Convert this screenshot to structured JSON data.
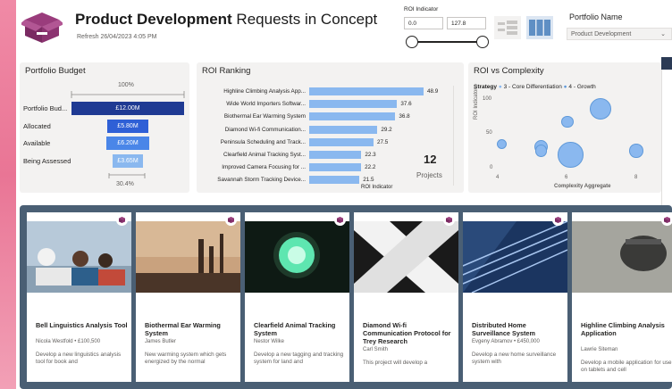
{
  "header": {
    "title_bold": "Product Development",
    "title_rest": " Requests in Concept",
    "refresh": "Refresh 26/04/2023 4:05 PM"
  },
  "roi_filter": {
    "label": "ROI Indicator",
    "min_value": "0.0",
    "max_value": "127.8"
  },
  "portfolio_filter": {
    "label": "Portfolio Name",
    "selected": "Product Development"
  },
  "portfolio_budget": {
    "title": "Portfolio Budget",
    "top_pct": "100%",
    "bottom_pct": "30.4%",
    "rows": [
      {
        "label": "Portfolio Bud...",
        "value": "£12.00M",
        "fraction": 1.0,
        "color": "#1f3a93"
      },
      {
        "label": "Allocated",
        "value": "£5.80M",
        "fraction": 0.483,
        "color": "#2f60d6"
      },
      {
        "label": "Available",
        "value": "£6.20M",
        "fraction": 0.517,
        "color": "#4a86e8"
      },
      {
        "label": "Being Assessed",
        "value": "£3.65M",
        "fraction": 0.304,
        "color": "#8ab8ef"
      }
    ]
  },
  "roi_ranking": {
    "title": "ROI Ranking",
    "axis_label": "ROI Indicator",
    "count": "12",
    "count_label": "Projects",
    "max": 48.9,
    "rows": [
      {
        "label": "Highline Climbing Analysis App...",
        "value": 48.9,
        "value_label": "48.9"
      },
      {
        "label": "Wide World Importers Softwar...",
        "value": 37.6,
        "value_label": "37.6"
      },
      {
        "label": "Biothermal Ear Warming System",
        "value": 36.8,
        "value_label": "36.8"
      },
      {
        "label": "Diamond Wi-fi Communication...",
        "value": 29.2,
        "value_label": "29.2"
      },
      {
        "label": "Peninsula Scheduling and Track...",
        "value": 27.5,
        "value_label": "27.5"
      },
      {
        "label": "Clearfield Animal Tracking Syst...",
        "value": 22.3,
        "value_label": "22.3"
      },
      {
        "label": "Improved Camera Focusing for ...",
        "value": 22.2,
        "value_label": "22.2"
      },
      {
        "label": "Savannah Storm Tracking Device...",
        "value": 21.5,
        "value_label": "21.5"
      }
    ]
  },
  "roi_complexity": {
    "title": "ROI vs Complexity",
    "legend_title": "Strategy",
    "legend_items": [
      {
        "label": "3 - Core Differentiation",
        "color": "#8ab8ef"
      },
      {
        "label": "4 - Growth",
        "color": "#5f99d9"
      }
    ],
    "y_label": "ROI Indicator",
    "x_label": "Complexity Aggregate",
    "y_ticks": [
      "100",
      "50",
      "0"
    ],
    "x_ticks": [
      "4",
      "6",
      "8"
    ]
  },
  "chart_data": {
    "type": "scatter",
    "xlabel": "Complexity Aggregate",
    "ylabel": "ROI Indicator",
    "xlim": [
      3.8,
      8.6
    ],
    "ylim": [
      0,
      115
    ],
    "points": [
      {
        "x": 6.9,
        "y": 92,
        "size": 11
      },
      {
        "x": 5.9,
        "y": 73,
        "size": 6
      },
      {
        "x": 3.9,
        "y": 40,
        "size": 5
      },
      {
        "x": 5.1,
        "y": 36,
        "size": 7
      },
      {
        "x": 5.1,
        "y": 30,
        "size": 6
      },
      {
        "x": 6.0,
        "y": 24,
        "size": 13
      },
      {
        "x": 8.0,
        "y": 30,
        "size": 7
      }
    ]
  },
  "cards": [
    {
      "title": "Bell Linguistics Analysis Tool",
      "meta": "Nicola Westfold • £100,500",
      "desc": "Develop a new linguistics analysis tool for book and"
    },
    {
      "title": "Biothermal Ear Warming System",
      "meta": "James Butler",
      "desc": "New warming system which gets energized by the normal"
    },
    {
      "title": "Clearfield Animal Tracking System",
      "meta": "Nestor Wilke",
      "desc": "Develop a new tagging and tracking system for land and"
    },
    {
      "title": "Diamond Wi-fi Communication Protocol for Trey Research",
      "meta": "Carl Smith",
      "desc": "This project will develop a"
    },
    {
      "title": "Distributed Home Surveillance System",
      "meta": "Evgeny Abramov • £450,000",
      "desc": "Develop a new home surveillance system with"
    },
    {
      "title": "Highline Climbing Analysis Application",
      "meta": "Lawrie Siteman",
      "desc": "Develop a mobile application for use on tablets and cell"
    }
  ]
}
